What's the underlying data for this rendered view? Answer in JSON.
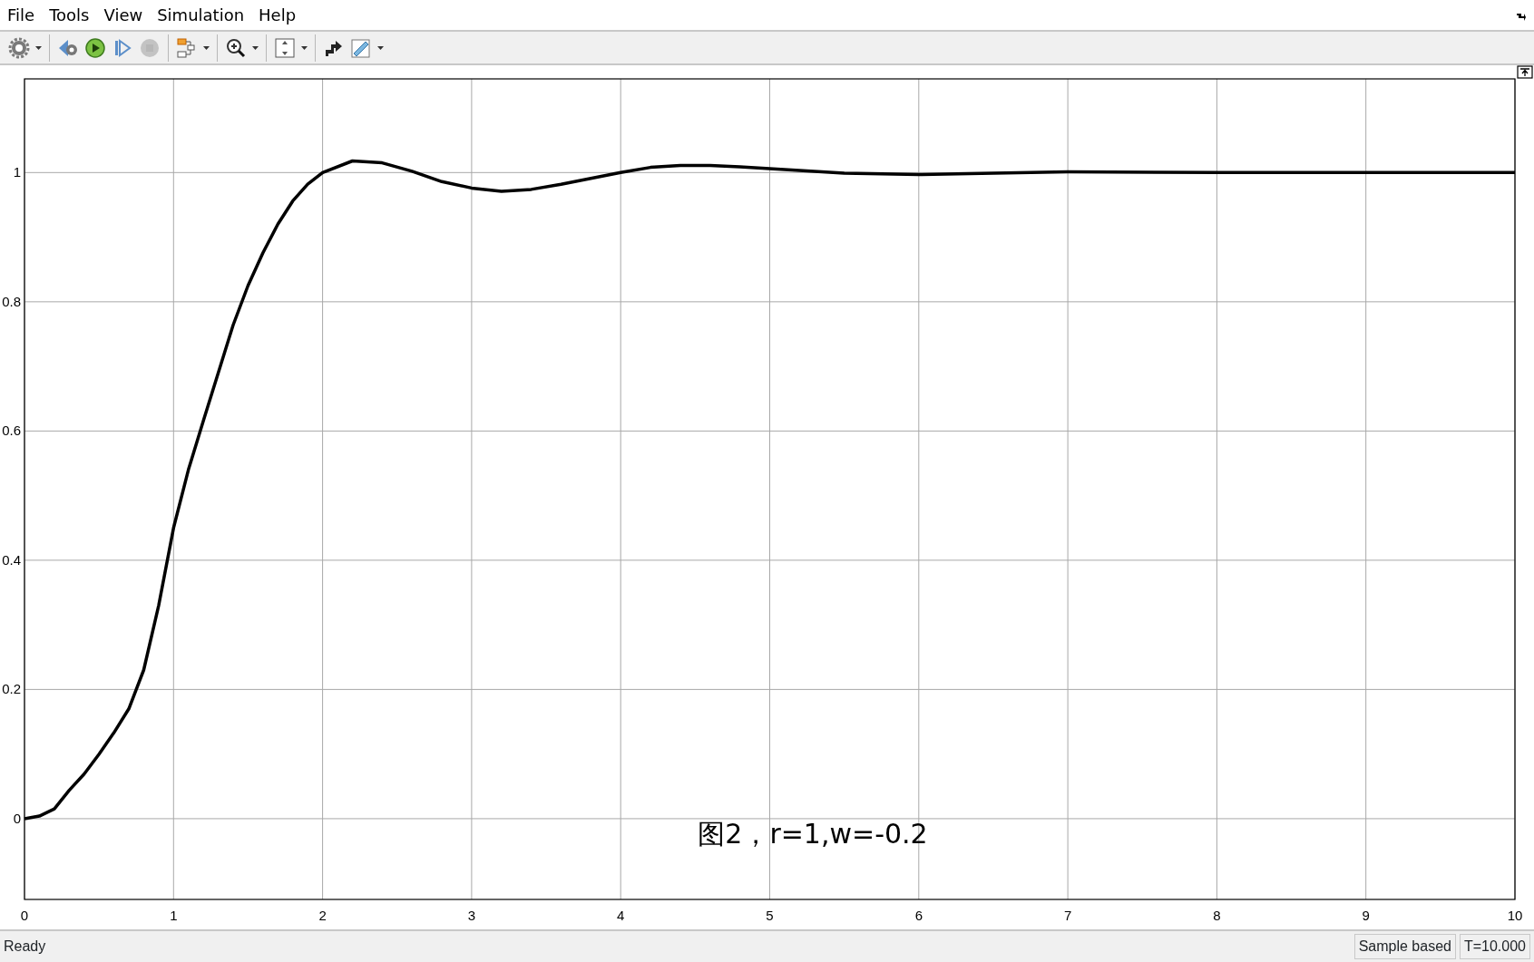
{
  "menu_bar": {
    "items": [
      "File",
      "Tools",
      "View",
      "Simulation",
      "Help"
    ]
  },
  "toolbar": {
    "buttons": [
      {
        "disabled": false,
        "dropdown": true
      },
      {
        "disabled": false,
        "dropdown": false
      },
      {
        "disabled": false,
        "dropdown": false
      },
      {
        "disabled": false,
        "dropdown": false
      },
      {
        "disabled": true,
        "dropdown": false
      },
      {
        "disabled": false,
        "dropdown": true
      },
      {
        "disabled": false,
        "dropdown": true
      },
      {
        "disabled": false,
        "dropdown": true
      },
      {
        "disabled": false,
        "dropdown": false
      },
      {
        "disabled": false,
        "dropdown": true
      }
    ]
  },
  "scope": {
    "chart_data": {
      "type": "line",
      "x": [
        0,
        0.1,
        0.2,
        0.3,
        0.4,
        0.5,
        0.6,
        0.7,
        0.8,
        0.9,
        1.0,
        1.1,
        1.2,
        1.3,
        1.4,
        1.5,
        1.6,
        1.7,
        1.8,
        1.9,
        2.0,
        2.2,
        2.4,
        2.6,
        2.8,
        3.0,
        3.2,
        3.4,
        3.6,
        3.8,
        4.0,
        4.2,
        4.4,
        4.6,
        4.8,
        5.0,
        5.5,
        6.0,
        6.5,
        7.0,
        8.0,
        9.0,
        10.0
      ],
      "series": [
        {
          "color": "#000000",
          "values": [
            0,
            0.004,
            0.015,
            0.044,
            0.069,
            0.1,
            0.133,
            0.17,
            0.23,
            0.33,
            0.45,
            0.54,
            0.616,
            0.69,
            0.764,
            0.825,
            0.876,
            0.92,
            0.956,
            0.982,
            1.0,
            1.018,
            1.015,
            1.002,
            0.986,
            0.976,
            0.971,
            0.974,
            0.982,
            0.991,
            1.0,
            1.008,
            1.011,
            1.011,
            1.009,
            1.006,
            0.999,
            0.997,
            0.999,
            1.001,
            1.0,
            1.0,
            1.0
          ]
        }
      ],
      "xlim": [
        0,
        10
      ],
      "ylim": [
        -0.125,
        1.145
      ],
      "xticks": [
        0,
        1,
        2,
        3,
        4,
        5,
        6,
        7,
        8,
        9,
        10
      ],
      "yticks": [
        0,
        0.2,
        0.4,
        0.6,
        0.8,
        1
      ],
      "grid": true,
      "annotations": [
        "图2，r=1,w=-0.2"
      ]
    }
  },
  "status_bar": {
    "message": "Ready",
    "mode": "Sample based",
    "time": "T=10.000"
  }
}
